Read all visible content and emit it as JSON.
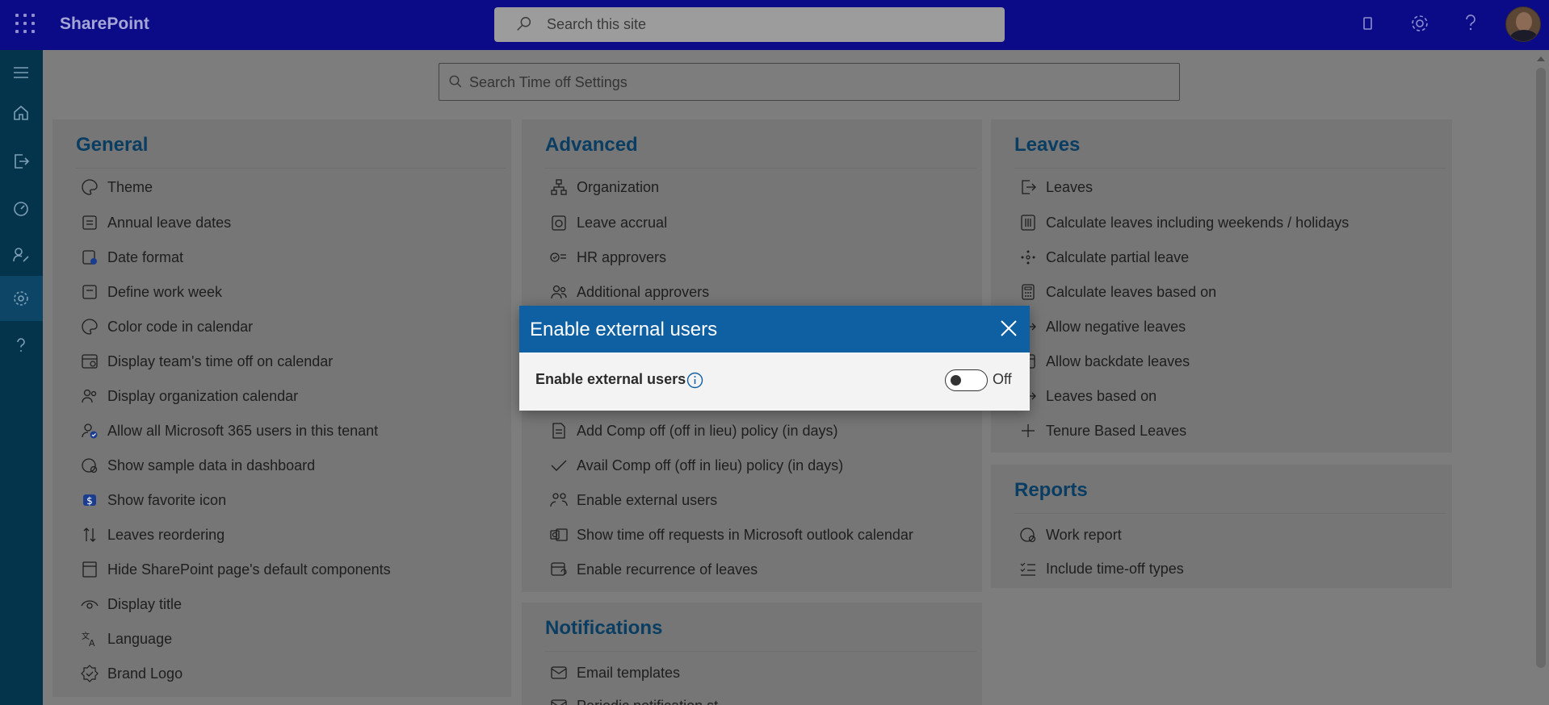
{
  "topbar": {
    "brand": "SharePoint",
    "search_placeholder": "Search this site"
  },
  "settings_search": {
    "placeholder": "Search Time off Settings"
  },
  "general": {
    "title": "General",
    "items": [
      {
        "label": "Theme",
        "icon": "palette-icon"
      },
      {
        "label": "Annual leave dates",
        "icon": "calendar-list-icon"
      },
      {
        "label": "Date format",
        "icon": "calendar-clock-icon"
      },
      {
        "label": "Define work week",
        "icon": "calendar-week-icon"
      },
      {
        "label": "Color code in calendar",
        "icon": "color-palette-icon"
      },
      {
        "label": "Display team's time off on calendar",
        "icon": "calendar-grid-icon"
      },
      {
        "label": "Display organization calendar",
        "icon": "people-icon"
      },
      {
        "label": "Allow all Microsoft 365 users in this tenant",
        "icon": "person-check-icon"
      },
      {
        "label": "Show sample data in dashboard",
        "icon": "dashboard-gear-icon"
      },
      {
        "label": "Show favorite icon",
        "icon": "favorite-dollar-icon"
      },
      {
        "label": "Leaves reordering",
        "icon": "sort-arrows-icon"
      },
      {
        "label": "Hide SharePoint page's default components",
        "icon": "page-layout-icon"
      },
      {
        "label": "Display title",
        "icon": "eye-icon"
      },
      {
        "label": "Language",
        "icon": "translate-icon"
      },
      {
        "label": "Brand Logo",
        "icon": "badge-check-icon"
      }
    ]
  },
  "advanced": {
    "title": "Advanced",
    "items": [
      {
        "label": "Organization",
        "icon": "org-chart-icon"
      },
      {
        "label": "Leave accrual",
        "icon": "accrual-icon"
      },
      {
        "label": "HR approvers",
        "icon": "checklist-icon"
      },
      {
        "label": "Additional approvers",
        "icon": "group-icon"
      },
      {
        "label": "Add Comp off (off in lieu) policy (in days)",
        "icon": "document-icon"
      },
      {
        "label": "Avail Comp off (off in lieu) policy (in days)",
        "icon": "checkmark-icon"
      },
      {
        "label": "Enable external users",
        "icon": "external-users-icon"
      },
      {
        "label": "Show time off requests in Microsoft outlook calendar",
        "icon": "outlook-icon"
      },
      {
        "label": "Enable recurrence of leaves",
        "icon": "calendar-repeat-icon"
      }
    ]
  },
  "leaves": {
    "title": "Leaves",
    "items": [
      {
        "label": "Leaves",
        "icon": "sign-out-icon"
      },
      {
        "label": "Calculate leaves including weekends / holidays",
        "icon": "calendar-columns-icon"
      },
      {
        "label": "Calculate partial leave",
        "icon": "partial-icon"
      },
      {
        "label": "Calculate leaves based on",
        "icon": "calculator-icon"
      },
      {
        "label": "Allow negative leaves",
        "icon": "sign-out-icon"
      },
      {
        "label": "Allow backdate leaves",
        "icon": "calendar-back-icon"
      },
      {
        "label": "Leaves based on",
        "icon": "sign-out-icon"
      },
      {
        "label": "Tenure Based Leaves",
        "icon": "plus-icon"
      }
    ]
  },
  "reports": {
    "title": "Reports",
    "items": [
      {
        "label": "Work report",
        "icon": "chart-gear-icon"
      },
      {
        "label": "Include time-off types",
        "icon": "list-check-icon"
      }
    ]
  },
  "notifications": {
    "title": "Notifications",
    "items": [
      {
        "label": "Email templates",
        "icon": "mail-icon"
      },
      {
        "label": "Periodic notification st",
        "icon": "mail-icon"
      }
    ]
  },
  "modal": {
    "title": "Enable external users",
    "field_label": "Enable external users",
    "toggle_state": "Off",
    "toggle_on": false
  }
}
